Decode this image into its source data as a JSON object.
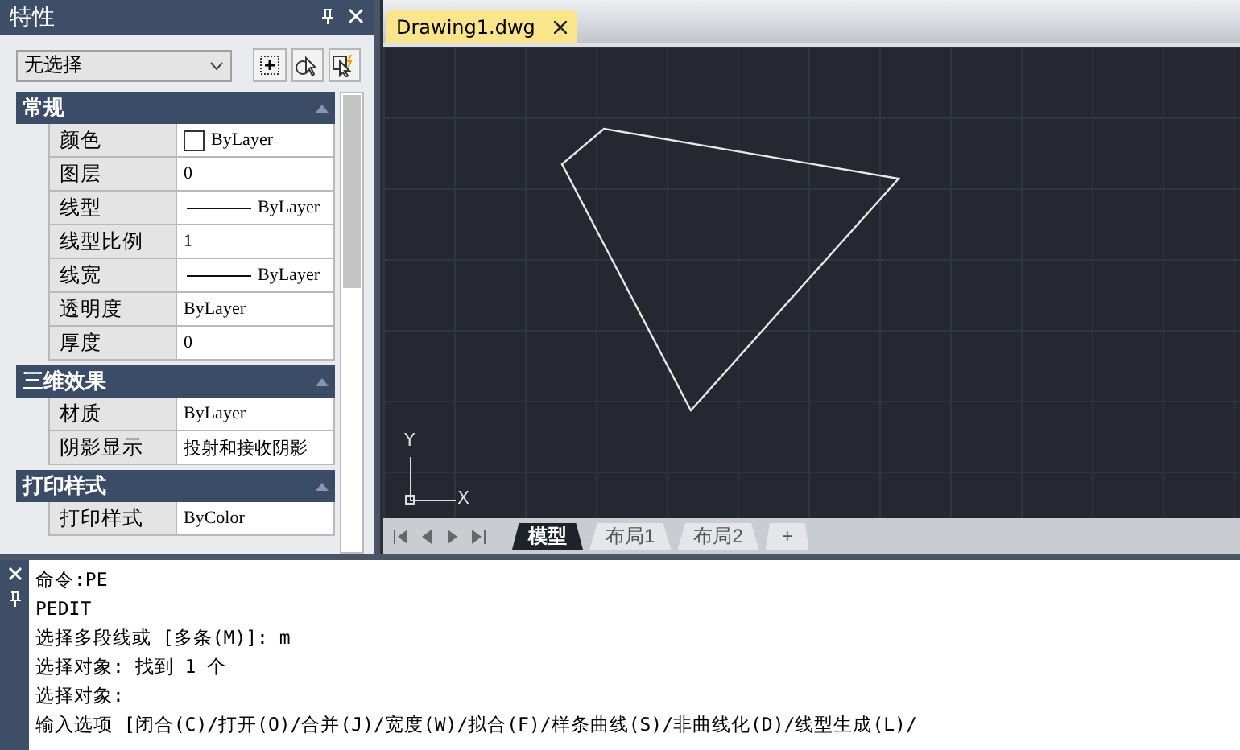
{
  "properties_panel": {
    "title": "特性",
    "selection": "无选择",
    "sections": [
      {
        "title": "常规",
        "expanded": true,
        "rows": [
          {
            "name": "颜色",
            "value": "ByLayer",
            "kind": "color"
          },
          {
            "name": "图层",
            "value": "0",
            "kind": "text"
          },
          {
            "name": "线型",
            "value": "ByLayer",
            "kind": "linetype"
          },
          {
            "name": "线型比例",
            "value": "1",
            "kind": "text"
          },
          {
            "name": "线宽",
            "value": "ByLayer",
            "kind": "linetype"
          },
          {
            "name": "透明度",
            "value": "ByLayer",
            "kind": "text"
          },
          {
            "name": "厚度",
            "value": "0",
            "kind": "text"
          }
        ]
      },
      {
        "title": "三维效果",
        "expanded": true,
        "rows": [
          {
            "name": "材质",
            "value": "ByLayer",
            "kind": "text"
          },
          {
            "name": "阴影显示",
            "value": "投射和接收阴影",
            "kind": "text"
          }
        ]
      },
      {
        "title": "打印样式",
        "expanded": true,
        "rows": [
          {
            "name": "打印样式",
            "value": "ByColor",
            "kind": "text"
          }
        ]
      }
    ]
  },
  "document_tab": {
    "title": "Drawing1.dwg"
  },
  "canvas": {
    "axis_x": "X",
    "axis_y": "Y"
  },
  "layout_tabs": [
    {
      "label": "模型",
      "selected": true
    },
    {
      "label": "布局1",
      "selected": false
    },
    {
      "label": "布局2",
      "selected": false
    },
    {
      "label": "+",
      "selected": false
    }
  ],
  "command_lines": [
    "命令:PE",
    "PEDIT",
    "选择多段线或 [多条(M)]: m",
    "选择对象: 找到 1 个",
    "选择对象:",
    "输入选项 [闭合(C)/打开(O)/合并(J)/宽度(W)/拟合(F)/样条曲线(S)/非曲线化(D)/线型生成(L)/"
  ]
}
